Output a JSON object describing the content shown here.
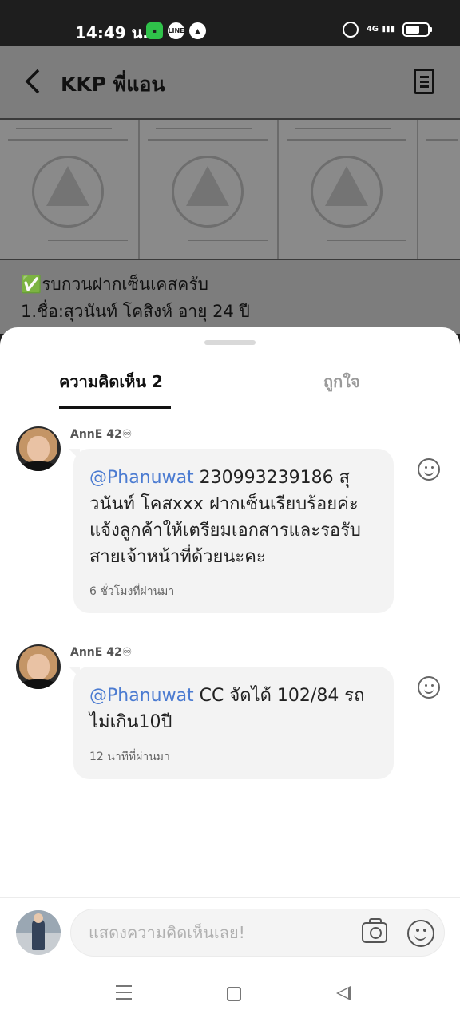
{
  "status_bar": {
    "time": "14:49 น.",
    "notification_icons": [
      "chat-icon",
      "line-icon",
      "navigation-icon"
    ],
    "line_label": "LINE",
    "network": "4G",
    "icons": [
      "alarm-icon",
      "signal-icon",
      "battery-icon"
    ]
  },
  "post": {
    "title": "KKP พี่แอน",
    "line1": "✅รบกวนฝากเซ็นเคสครับ",
    "line2": "1.ชื่อ:สุวนันท์ โคสิงห์ อายุ 24 ปี"
  },
  "sheet": {
    "tabs": [
      {
        "label": "ความคิดเห็น 2",
        "active": true
      },
      {
        "label": "ถูกใจ",
        "active": false
      }
    ]
  },
  "comments": [
    {
      "author": "AnnE 42♾",
      "mention": "@Phanuwat",
      "text_lines": [
        " 230993239186 สุ",
        "วนันท์ โคสxxx ฝากเซ็นเรียบร้อยค่ะ",
        "แจ้งลูกค้าให้เตรียมเอกสารและรอรับ",
        "สายเจ้าหน้าที่ด้วยนะคะ"
      ],
      "time": "6 ชั่วโมงที่ผ่านมา"
    },
    {
      "author": "AnnE 42♾",
      "mention": "@Phanuwat",
      "text_lines": [
        " CC จัดได้ 102/84 รถ",
        "ไม่เกิน10ปี"
      ],
      "time": "12 นาทีที่ผ่านมา"
    }
  ],
  "input": {
    "placeholder": "แสดงความคิดเห็นเลย!"
  },
  "colors": {
    "mention": "#4b7bd1",
    "sheet_bg": "#ffffff",
    "bubble_bg": "#f3f3f3",
    "dim_overlay": "#7d7d7d"
  }
}
